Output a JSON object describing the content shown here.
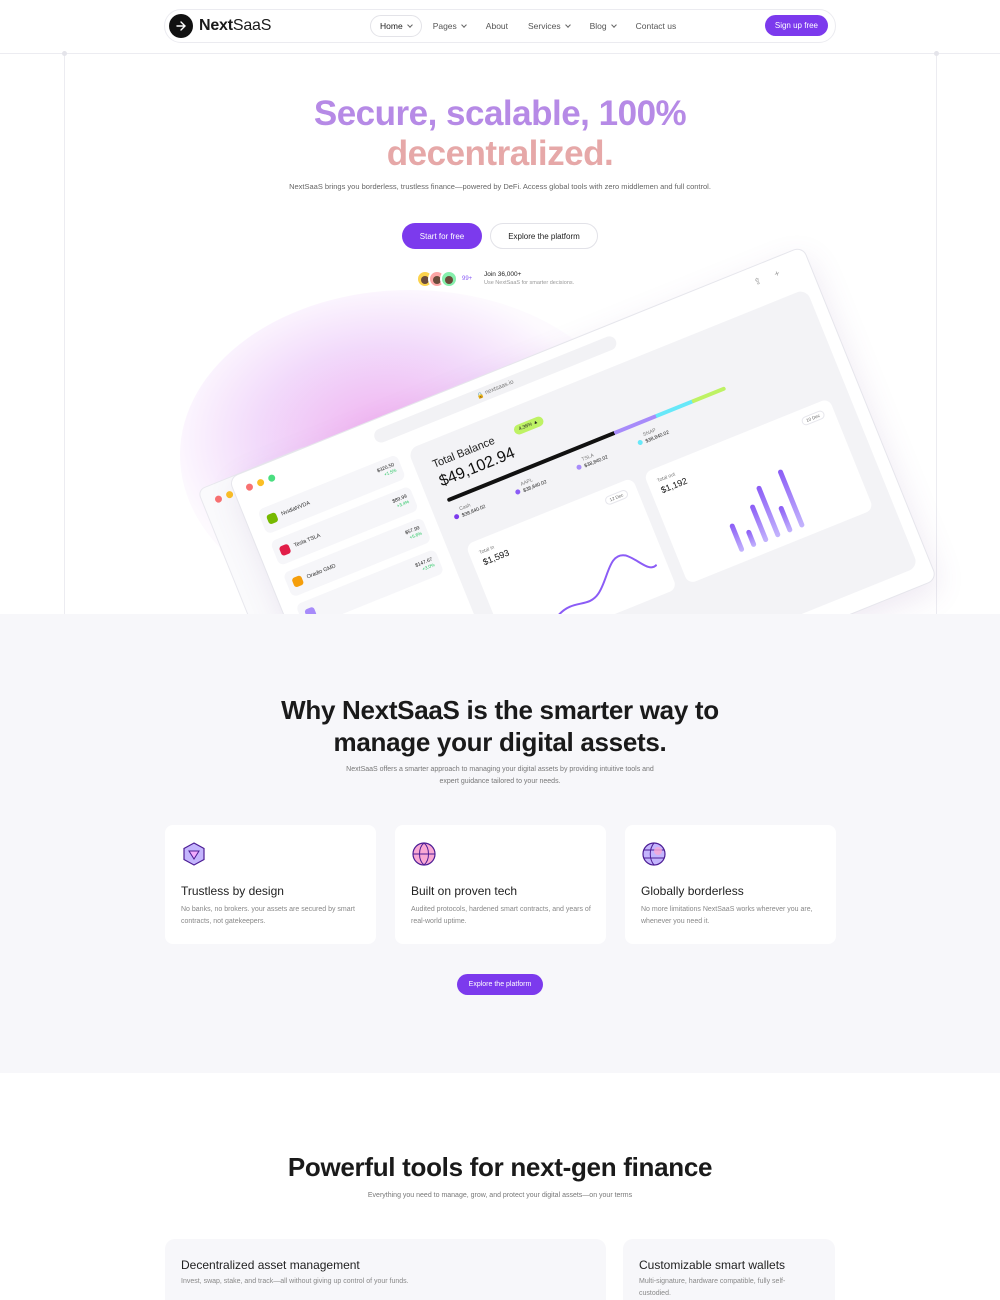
{
  "header": {
    "logo_text_bold": "Next",
    "logo_text_light": "SaaS",
    "nav": [
      {
        "label": "Home",
        "dropdown": true,
        "active": true
      },
      {
        "label": "Pages",
        "dropdown": true
      },
      {
        "label": "About",
        "dropdown": false
      },
      {
        "label": "Services",
        "dropdown": true
      },
      {
        "label": "Blog",
        "dropdown": true
      },
      {
        "label": "Contact us",
        "dropdown": false
      }
    ],
    "signup_label": "Sign up free"
  },
  "hero": {
    "title_line1": "Secure, scalable, 100%",
    "title_line2": "decentralized.",
    "subtitle": "NextSaaS brings you borderless, trustless finance—powered by DeFi. Access global tools with zero middlemen and full control.",
    "primary_cta": "Start for free",
    "secondary_cta": "Explore the platform",
    "avatars_more": "99+",
    "join_title": "Join 36,000+",
    "join_sub": "Use NextSaaS for smarter decisions."
  },
  "mockup": {
    "url": "nextsaas.io",
    "assets": [
      {
        "name": "NvidiaNVDA",
        "value": "$320.50",
        "change": "+1.5%"
      },
      {
        "name": "Tesla TSLA",
        "value": "$89.99",
        "change": "+3.4%"
      },
      {
        "name": "Oradio GMD",
        "value": "$57.99",
        "change": "+5.6%"
      },
      {
        "name": "",
        "value": "$147.67",
        "change": "+3.0%"
      }
    ],
    "balance_label": "Total Balance",
    "balance_value": "$49,102.94",
    "balance_badge": "4.36% ▲",
    "legend": [
      {
        "label": "Cash",
        "value": "$38,840.02"
      },
      {
        "label": "AAPL",
        "value": "$38,840.02"
      },
      {
        "label": "TSLA",
        "value": "$38,840.02"
      },
      {
        "label": "SNAP",
        "value": "$38,840.02"
      }
    ],
    "total_in_label": "Total in",
    "total_in_value": "$1,593",
    "total_in_range": "12 Dec",
    "total_out_label": "Total out",
    "total_out_value": "$1,192",
    "total_out_range": "10 Dec"
  },
  "why": {
    "title_line1": "Why NextSaaS is the smarter way to",
    "title_line2": "manage your digital assets.",
    "subtitle": "NextSaaS offers a smarter approach to managing your digital assets by providing intuitive tools and expert guidance tailored to your needs.",
    "features": [
      {
        "title": "Trustless by design",
        "text": "No banks, no brokers. your assets are secured by smart contracts, not gatekeepers.",
        "icon": "cube-icon"
      },
      {
        "title": "Built on proven tech",
        "text": "Audited protocols, hardened smart contracts, and years of real-world uptime.",
        "icon": "sphere-icon"
      },
      {
        "title": "Globally borderless",
        "text": "No more limitations NextSaaS works wherever you are, whenever you need it.",
        "icon": "globe-icon"
      }
    ],
    "cta": "Explore the platform"
  },
  "tools": {
    "title": "Powerful tools for next-gen finance",
    "subtitle": "Everything you need to manage, grow, and protect your digital assets—on your terms",
    "cards": [
      {
        "title": "Decentralized asset management",
        "text": "Invest, swap, stake, and track—all without giving up control of your funds."
      },
      {
        "title": "Customizable smart wallets",
        "text": "Multi-signature, hardware compatible, fully self-custodied."
      }
    ]
  },
  "colors": {
    "accent": "#7c3aed",
    "title_purple": "#b68ae6",
    "title_pink": "#e6a8a8"
  }
}
